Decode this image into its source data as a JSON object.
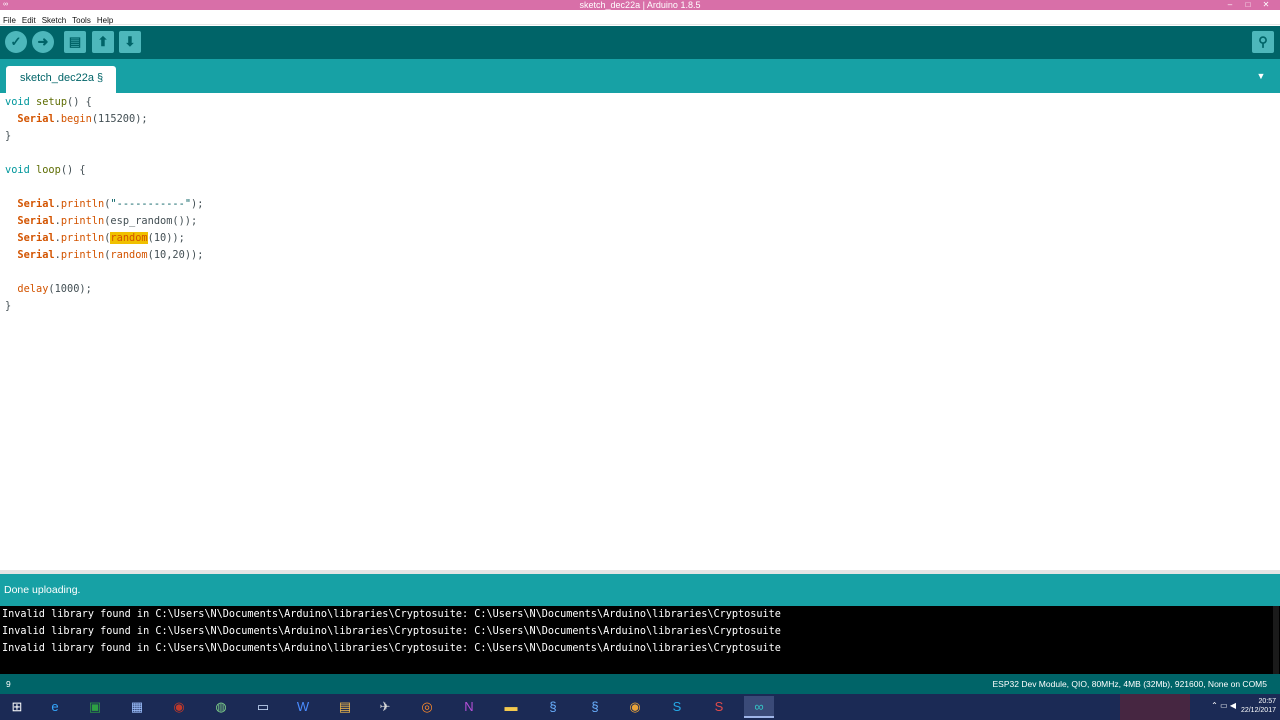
{
  "window": {
    "title": "sketch_dec22a | Arduino 1.8.5",
    "controls": [
      "–",
      "□",
      "✕"
    ]
  },
  "menubar": {
    "items": [
      "File",
      "Edit",
      "Sketch",
      "Tools",
      "Help"
    ]
  },
  "toolbar": {
    "buttons": [
      {
        "name": "verify",
        "icon": "check-icon",
        "glyph": "✓"
      },
      {
        "name": "upload",
        "icon": "arrow-right-icon",
        "glyph": "➜"
      },
      {
        "name": "new",
        "icon": "document-icon",
        "glyph": "▤"
      },
      {
        "name": "open",
        "icon": "arrow-up-icon",
        "glyph": "⬆"
      },
      {
        "name": "save",
        "icon": "arrow-down-icon",
        "glyph": "⬇"
      }
    ],
    "serial_monitor_glyph": "⚲"
  },
  "tabs": {
    "active_tab": "sketch_dec22a §",
    "menu_glyph": "▼"
  },
  "editor": {
    "lines": [
      {
        "parts": [
          {
            "t": "void",
            "c": "kw-type"
          },
          {
            "t": " "
          },
          {
            "t": "setup",
            "c": "kw-fn"
          },
          {
            "t": "() {"
          }
        ]
      },
      {
        "parts": [
          {
            "t": "  "
          },
          {
            "t": "Serial",
            "c": "kw-class"
          },
          {
            "t": "."
          },
          {
            "t": "begin",
            "c": "kw-method"
          },
          {
            "t": "(115200);"
          }
        ]
      },
      {
        "parts": [
          {
            "t": "}"
          }
        ]
      },
      {
        "parts": [
          {
            "t": ""
          }
        ]
      },
      {
        "parts": [
          {
            "t": "void",
            "c": "kw-type"
          },
          {
            "t": " "
          },
          {
            "t": "loop",
            "c": "kw-fn"
          },
          {
            "t": "() {"
          }
        ]
      },
      {
        "parts": [
          {
            "t": ""
          }
        ]
      },
      {
        "parts": [
          {
            "t": "  "
          },
          {
            "t": "Serial",
            "c": "kw-class"
          },
          {
            "t": "."
          },
          {
            "t": "println",
            "c": "kw-method"
          },
          {
            "t": "("
          },
          {
            "t": "\"-----------\"",
            "c": "str"
          },
          {
            "t": ");"
          }
        ]
      },
      {
        "parts": [
          {
            "t": "  "
          },
          {
            "t": "Serial",
            "c": "kw-class"
          },
          {
            "t": "."
          },
          {
            "t": "println",
            "c": "kw-method"
          },
          {
            "t": "(esp_random());"
          }
        ]
      },
      {
        "parts": [
          {
            "t": "  "
          },
          {
            "t": "Serial",
            "c": "kw-class"
          },
          {
            "t": "."
          },
          {
            "t": "println",
            "c": "kw-method"
          },
          {
            "t": "("
          },
          {
            "t": "random",
            "c": "hl"
          },
          {
            "t": "(10));"
          }
        ]
      },
      {
        "parts": [
          {
            "t": "  "
          },
          {
            "t": "Serial",
            "c": "kw-class"
          },
          {
            "t": "."
          },
          {
            "t": "println",
            "c": "kw-method"
          },
          {
            "t": "("
          },
          {
            "t": "random",
            "c": "kw-method"
          },
          {
            "t": "(10,20));"
          }
        ]
      },
      {
        "parts": [
          {
            "t": ""
          }
        ]
      },
      {
        "parts": [
          {
            "t": "  "
          },
          {
            "t": "delay",
            "c": "kw-method"
          },
          {
            "t": "(1000);"
          }
        ]
      },
      {
        "parts": [
          {
            "t": "}"
          }
        ]
      }
    ]
  },
  "status": {
    "message": "Done uploading."
  },
  "console": {
    "lines": [
      "Invalid library found in C:\\Users\\N\\Documents\\Arduino\\libraries\\Cryptosuite: C:\\Users\\N\\Documents\\Arduino\\libraries\\Cryptosuite",
      "Invalid library found in C:\\Users\\N\\Documents\\Arduino\\libraries\\Cryptosuite: C:\\Users\\N\\Documents\\Arduino\\libraries\\Cryptosuite",
      "Invalid library found in C:\\Users\\N\\Documents\\Arduino\\libraries\\Cryptosuite: C:\\Users\\N\\Documents\\Arduino\\libraries\\Cryptosuite"
    ]
  },
  "infobar": {
    "line_number": "9",
    "board": "ESP32 Dev Module, QIO, 80MHz, 4MB (32Mb), 921600, None on COM5"
  },
  "taskbar": {
    "items": [
      {
        "icon": "windows-start-icon",
        "glyph": "⊞",
        "color": "#ffffff"
      },
      {
        "icon": "internet-explorer-icon",
        "glyph": "e",
        "color": "#35a8ff"
      },
      {
        "icon": "app-green-icon",
        "glyph": "▣",
        "color": "#2ea043"
      },
      {
        "icon": "monitor-app-icon",
        "glyph": "▦",
        "color": "#9ec1ff"
      },
      {
        "icon": "app-red-icon",
        "glyph": "◉",
        "color": "#c0392b"
      },
      {
        "icon": "app-disc-icon",
        "glyph": "◍",
        "color": "#7fd18a"
      },
      {
        "icon": "remote-desktop-icon",
        "glyph": "▭",
        "color": "#cfe3ff"
      },
      {
        "icon": "word-icon",
        "glyph": "W",
        "color": "#4a8cff"
      },
      {
        "icon": "file-icon",
        "glyph": "▤",
        "color": "#f0b84a"
      },
      {
        "icon": "app-plane-icon",
        "glyph": "✈",
        "color": "#d8d8d8"
      },
      {
        "icon": "firefox-icon",
        "glyph": "◎",
        "color": "#ff8a2a"
      },
      {
        "icon": "onenote-icon",
        "glyph": "N",
        "color": "#b34fd6"
      },
      {
        "icon": "folder-icon",
        "glyph": "▬",
        "color": "#f3c94e"
      },
      {
        "icon": "app-s-icon",
        "glyph": "§",
        "color": "#6ab0ff"
      },
      {
        "icon": "app-s2-icon",
        "glyph": "§",
        "color": "#6ab0ff"
      },
      {
        "icon": "chrome-icon",
        "glyph": "◉",
        "color": "#e8a33a"
      },
      {
        "icon": "skype-icon",
        "glyph": "S",
        "color": "#25a8e6"
      },
      {
        "icon": "app-s3-icon",
        "glyph": "S",
        "color": "#e04b4b"
      },
      {
        "icon": "arduino-icon",
        "glyph": "∞",
        "color": "#34c6c6"
      }
    ],
    "clock_time": "20:57",
    "clock_date": "22/12/2017"
  },
  "colors": {
    "toolbar": "#006468",
    "tabstrip": "#17a1a5",
    "titlebar": "#d86fa8",
    "highlight": "#f0c000"
  }
}
